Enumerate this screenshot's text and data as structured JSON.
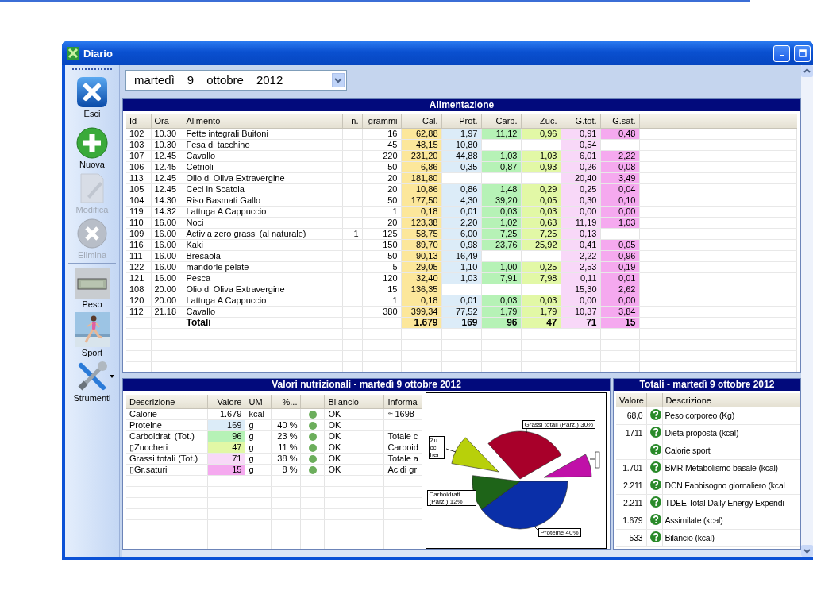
{
  "window": {
    "title": "Diario"
  },
  "toolbar": [
    {
      "label": "Esci",
      "kind": "exit",
      "disabled": false
    },
    {
      "label": "Nuova",
      "kind": "add",
      "disabled": false
    },
    {
      "label": "Modifica",
      "kind": "edit",
      "disabled": true
    },
    {
      "label": "Elimina",
      "kind": "delete",
      "disabled": true
    },
    {
      "label": "Peso",
      "kind": "scale",
      "disabled": false
    },
    {
      "label": "Sport",
      "kind": "sport",
      "disabled": false
    },
    {
      "label": "Strumenti",
      "kind": "tools",
      "disabled": false
    }
  ],
  "date": {
    "parts": [
      "martedì",
      "9",
      "ottobre",
      "2012"
    ]
  },
  "food_panel": {
    "title": "Alimentazione",
    "columns": [
      {
        "label": "Id"
      },
      {
        "label": "Ora"
      },
      {
        "label": "Alimento"
      },
      {
        "label": "n."
      },
      {
        "label": "grammi"
      },
      {
        "label": "Cal.",
        "color": "#fce79b"
      },
      {
        "label": "Prot.",
        "color": "#dcecf8"
      },
      {
        "label": "Carb.",
        "color": "#b6f2b6"
      },
      {
        "label": "Zuc.",
        "color": "#e2f8a6"
      },
      {
        "label": "G.tot.",
        "color": "#f8d8f8"
      },
      {
        "label": "G.sat.",
        "color": "#f5a9ef"
      }
    ],
    "rows": [
      {
        "kind": "item",
        "cells": [
          "102",
          "10.30",
          "Fette integrali Buitoni",
          null,
          "16",
          "62,88",
          "1,97",
          "11,12",
          "0,96",
          "0,91",
          "0,48"
        ]
      },
      {
        "kind": "item",
        "cells": [
          "103",
          "10.30",
          "Fesa di tacchino",
          null,
          "45",
          "48,15",
          "10,80",
          null,
          null,
          "0,54",
          null
        ]
      },
      {
        "kind": "item",
        "cells": [
          "107",
          "12.45",
          "Cavallo",
          null,
          "220",
          "231,20",
          "44,88",
          "1,03",
          "1,03",
          "6,01",
          "2,22"
        ]
      },
      {
        "kind": "item",
        "cells": [
          "106",
          "12.45",
          "Cetrioli",
          null,
          "50",
          "6,86",
          "0,35",
          "0,87",
          "0,93",
          "0,26",
          "0,08"
        ]
      },
      {
        "kind": "item",
        "cells": [
          "113",
          "12.45",
          "Olio di Oliva Extravergine",
          null,
          "20",
          "181,80",
          null,
          null,
          null,
          "20,40",
          "3,49"
        ]
      },
      {
        "kind": "item",
        "cells": [
          "105",
          "12.45",
          "Ceci in Scatola",
          null,
          "20",
          "10,86",
          "0,86",
          "1,48",
          "0,29",
          "0,25",
          "0,04"
        ]
      },
      {
        "kind": "item",
        "cells": [
          "104",
          "14.30",
          "Riso Basmati Gallo",
          null,
          "50",
          "177,50",
          "4,30",
          "39,20",
          "0,05",
          "0,30",
          "0,10"
        ]
      },
      {
        "kind": "item",
        "cells": [
          "119",
          "14.32",
          "Lattuga A Cappuccio",
          null,
          "1",
          "0,18",
          "0,01",
          "0,03",
          "0,03",
          "0,00",
          "0,00"
        ]
      },
      {
        "kind": "item",
        "cells": [
          "110",
          "16.00",
          "Noci",
          null,
          "20",
          "123,38",
          "2,20",
          "1,02",
          "0,63",
          "11,19",
          "1,03"
        ]
      },
      {
        "kind": "item",
        "cells": [
          "109",
          "16.00",
          "Activia zero grassi (al naturale)",
          "1",
          "125",
          "58,75",
          "6,00",
          "7,25",
          "7,25",
          "0,13",
          null
        ]
      },
      {
        "kind": "item",
        "cells": [
          "116",
          "16.00",
          "Kaki",
          null,
          "150",
          "89,70",
          "0,98",
          "23,76",
          "25,92",
          "0,41",
          "0,05"
        ]
      },
      {
        "kind": "item",
        "cells": [
          "111",
          "16.00",
          "Bresaola",
          null,
          "50",
          "90,13",
          "16,49",
          null,
          null,
          "2,22",
          "0,96"
        ]
      },
      {
        "kind": "item",
        "cells": [
          "122",
          "16.00",
          "mandorle pelate",
          null,
          "5",
          "29,05",
          "1,10",
          "1,00",
          "0,25",
          "2,53",
          "0,19"
        ]
      },
      {
        "kind": "item",
        "cells": [
          "121",
          "16.00",
          "Pesca",
          null,
          "120",
          "32,40",
          "1,03",
          "7,91",
          "7,98",
          "0,11",
          "0,01"
        ]
      },
      {
        "kind": "item",
        "cells": [
          "108",
          "20.00",
          "Olio di Oliva Extravergine",
          null,
          "15",
          "136,35",
          null,
          null,
          null,
          "15,30",
          "2,62"
        ]
      },
      {
        "kind": "item",
        "cells": [
          "120",
          "20.00",
          "Lattuga A Cappuccio",
          null,
          "1",
          "0,18",
          "0,01",
          "0,03",
          "0,03",
          "0,00",
          "0,00"
        ]
      },
      {
        "kind": "item",
        "cells": [
          "112",
          "21.18",
          "Cavallo",
          null,
          "380",
          "399,34",
          "77,52",
          "1,79",
          "1,79",
          "10,37",
          "3,84"
        ]
      },
      {
        "kind": "total",
        "cells": [
          null,
          null,
          "Totali",
          null,
          null,
          "1.679",
          "169",
          "96",
          "47",
          "71",
          "15"
        ]
      }
    ]
  },
  "nutrition_panel": {
    "title": "Valori nutrizionali - martedì 9 ottobre 2012",
    "columns": [
      "Descrizione",
      "Valore",
      "UM",
      "%...",
      null,
      "Bilancio",
      "Informa"
    ],
    "rows": [
      {
        "descrizione": "Calorie",
        "valore": "1.679",
        "um": "kcal",
        "bilancio": "OK",
        "info": "≈ 1698"
      },
      {
        "descrizione": "Proteine",
        "valore": "169",
        "color": "#dcecf8",
        "um": "g",
        "percent": "40 %",
        "bilancio": "OK"
      },
      {
        "descrizione": "Carboidrati (Tot.)",
        "valore": "96",
        "color": "#b6f2b6",
        "um": "g",
        "percent": "23 %",
        "bilancio": "OK",
        "info": "Totale c"
      },
      {
        "descrizione": "▯Zuccheri",
        "valore": "47",
        "color": "#e2f8a6",
        "um": "g",
        "percent": "11 %",
        "bilancio": "OK",
        "info": "Carboid"
      },
      {
        "descrizione": "Grassi totali (Tot.)",
        "valore": "71",
        "color": "#f8d8f8",
        "um": "g",
        "percent": "38 %",
        "bilancio": "OK",
        "info": "Totale a"
      },
      {
        "descrizione": "▯Gr.saturi",
        "valore": "15",
        "color": "#f5a9ef",
        "um": "g",
        "percent": "8 %",
        "bilancio": "OK",
        "info": "Acidi gr"
      }
    ],
    "pie_labels": [
      "Grassi totali (Parz.) 30%",
      "Zu cc. her",
      "Carboidrati (Parz.) 12%",
      "Proteine 40%"
    ]
  },
  "totals_panel": {
    "title": "Totali - martedì 9 ottobre 2012",
    "columns": [
      "Valore",
      null,
      "Descrizione"
    ],
    "rows": [
      {
        "valore": "68,0",
        "descrizione": "Peso corporeo (Kg)"
      },
      {
        "valore": "1711",
        "descrizione": "Dieta proposta (kcal)"
      },
      {
        "descrizione": "Calorie sport"
      },
      {
        "valore": "1.701",
        "descrizione": "BMR Metabolismo basale (kcal)"
      },
      {
        "valore": "2.211",
        "descrizione": "DCN Fabbisogno giornaliero (kcal"
      },
      {
        "valore": "2.211",
        "descrizione": "TDEE Total Daily Energy Expendi"
      },
      {
        "valore": "1.679",
        "descrizione": "Assimilate (kcal)"
      },
      {
        "valore": "-533",
        "descrizione": "Bilancio (kcal)"
      }
    ]
  }
}
